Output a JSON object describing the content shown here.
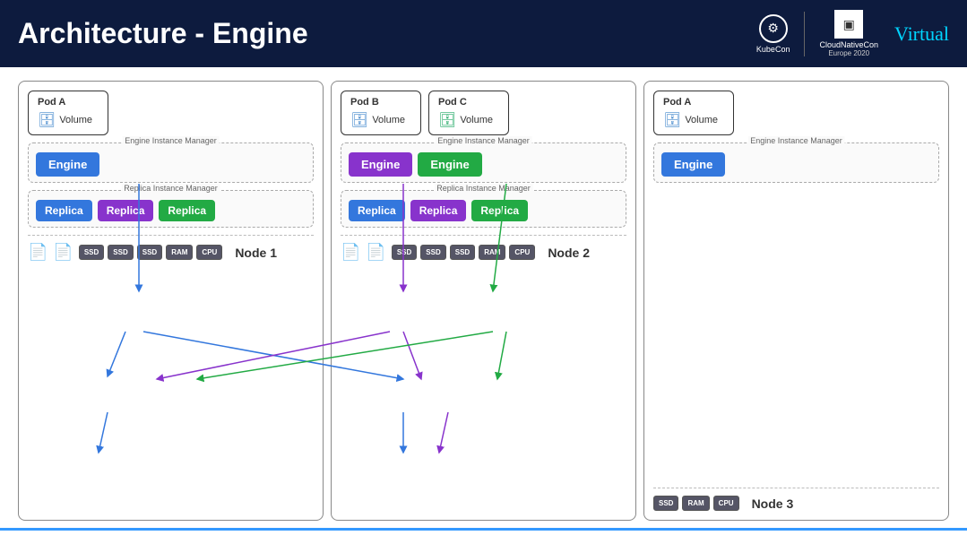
{
  "header": {
    "title": "Architecture - Engine",
    "logo": {
      "kubecon": "KubeCon",
      "cloudnative": "CloudNativeCon",
      "event": "Europe 2020",
      "virtual": "Virtual"
    }
  },
  "nodes": [
    {
      "id": "node1",
      "name": "Node 1",
      "pods": [
        {
          "id": "podA1",
          "label": "Pod A",
          "volume_color": "blue"
        }
      ],
      "engines": [
        {
          "label": "Engine",
          "color": "blue"
        }
      ],
      "engine_manager_label": "Engine Instance Manager",
      "replicas": [
        {
          "label": "Replica",
          "color": "blue"
        },
        {
          "label": "Replica",
          "color": "purple"
        },
        {
          "label": "Replica",
          "color": "green"
        }
      ],
      "replica_manager_label": "Replica Instance Manager",
      "hardware": [
        "SSD",
        "SSD",
        "SSD",
        "RAM",
        "CPU"
      ],
      "doc_icons": 2
    },
    {
      "id": "node2",
      "name": "Node 2",
      "pods": [
        {
          "id": "podB",
          "label": "Pod B",
          "volume_color": "blue"
        },
        {
          "id": "podC",
          "label": "Pod C",
          "volume_color": "green"
        }
      ],
      "engines": [
        {
          "label": "Engine",
          "color": "purple"
        },
        {
          "label": "Engine",
          "color": "green"
        }
      ],
      "engine_manager_label": "Engine Instance Manager",
      "replicas": [
        {
          "label": "Replica",
          "color": "blue"
        },
        {
          "label": "Replica",
          "color": "purple"
        },
        {
          "label": "Replica",
          "color": "green"
        }
      ],
      "replica_manager_label": "Replica Instance Manager",
      "hardware": [
        "SSD",
        "SSD",
        "SSD",
        "RAM",
        "CPU"
      ],
      "doc_icons": 2
    },
    {
      "id": "node3",
      "name": "Node 3",
      "pods": [
        {
          "id": "podA3",
          "label": "Pod A",
          "volume_color": "blue"
        }
      ],
      "engines": [
        {
          "label": "Engine",
          "color": "blue"
        }
      ],
      "engine_manager_label": "Engine Instance Manager",
      "replicas": [],
      "replica_manager_label": "",
      "hardware": [
        "SSD",
        "RAM",
        "CPU"
      ],
      "doc_icons": 0
    }
  ]
}
